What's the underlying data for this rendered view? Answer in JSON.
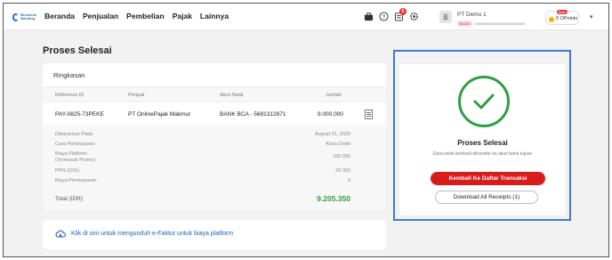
{
  "brand": {
    "logo_text": "Business Banking",
    "accent": "#1e6fc8"
  },
  "nav": {
    "items": [
      {
        "label": "Beranda"
      },
      {
        "label": "Penjualan"
      },
      {
        "label": "Pembelian"
      },
      {
        "label": "Pajak"
      },
      {
        "label": "Lainnya"
      }
    ]
  },
  "header": {
    "notification_count": "6",
    "company_name": "PT Demo 1",
    "role_badge": "Badan",
    "company_email": "xxxxxxxxxxxxxxxxxxxxxxxxx",
    "points_badge": "Baru",
    "points": "0 OPoints",
    "icons": [
      "briefcase-icon",
      "help-icon",
      "notification-icon",
      "settings-icon",
      "building-icon",
      "chevron-down-icon"
    ]
  },
  "page": {
    "title": "Proses Selesai"
  },
  "summary": {
    "title": "Ringkasan",
    "columns": [
      "Reference ID",
      "Penjual",
      "Akun Bank",
      "Jumlah"
    ],
    "row": {
      "reference_id": "PAY-0825-73PEKE",
      "seller": "PT OnlinePajak Makmur",
      "bank": "BANK BCA - 5681312871",
      "amount": "9.000.000"
    },
    "details": [
      {
        "label": "Dibayarkan Pada",
        "value": "August 01, 2025"
      },
      {
        "label": "Cara Pembayaran",
        "value": "Kartu Debit"
      },
      {
        "label": "Biaya Platform\n(Termasuk Promo)",
        "value": "185.000"
      },
      {
        "label": "PPN (11%)",
        "value": "20.350"
      },
      {
        "label": "Biaya Pembayaran",
        "value": "0"
      }
    ],
    "total_label": "Total (IDR)",
    "total_value": "9.205.350",
    "total_color": "#2e9e44"
  },
  "efaktur": {
    "link_text": "Klik di sini untuk mengunduh e-Faktur untuk biaya platform"
  },
  "success": {
    "title": "Proses Selesai",
    "subtitle": "Dana telah berhasil ditransfer ke akun bank tujuan",
    "back_button": "Kembali Ke Daftar Transaksi",
    "download_button": "Download All Receipts (1)",
    "color": "#2e9e44",
    "button_color": "#d81b1b"
  }
}
